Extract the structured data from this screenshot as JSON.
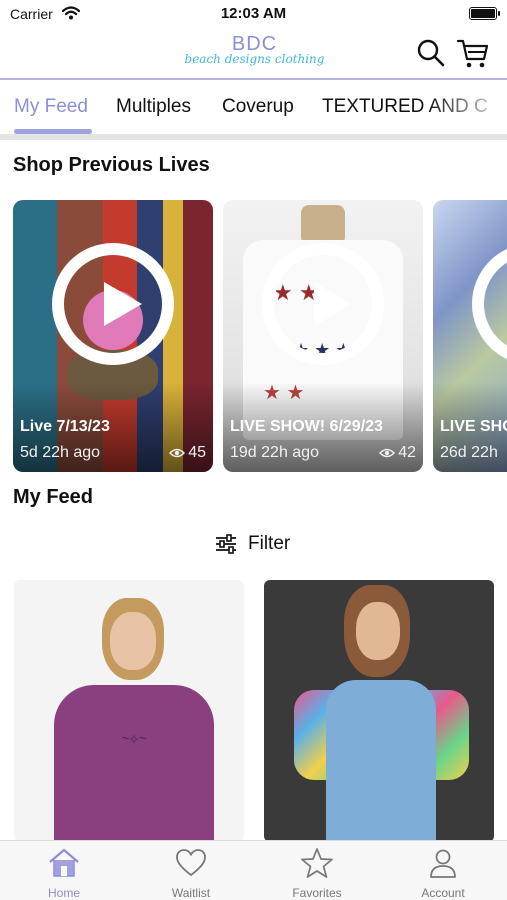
{
  "status_bar": {
    "carrier": "Carrier",
    "time": "12:03 AM"
  },
  "header": {
    "logo_mono": "BDC",
    "logo_script": "beach designs clothing"
  },
  "tabs": [
    {
      "label": "My Feed",
      "active": true
    },
    {
      "label": "Multiples",
      "active": false
    },
    {
      "label": "Coverup",
      "active": false
    },
    {
      "label": "TEXTURED AND C",
      "active": false
    }
  ],
  "sections": {
    "previous_lives": "Shop Previous Lives",
    "feed": "My Feed"
  },
  "lives": [
    {
      "title": "Live 7/13/23",
      "ago": "5d 22h ago",
      "views": "45"
    },
    {
      "title": "LIVE SHOW! 6/29/23",
      "ago": "19d 22h ago",
      "views": "42"
    },
    {
      "title": "LIVE SHO",
      "ago": "26d 22h",
      "views": ""
    }
  ],
  "filter": {
    "label": "Filter"
  },
  "bottom_nav": [
    {
      "label": "Home",
      "icon": "home-icon",
      "active": true
    },
    {
      "label": "Waitlist",
      "icon": "heart-icon",
      "active": false
    },
    {
      "label": "Favorites",
      "icon": "star-icon",
      "active": false
    },
    {
      "label": "Account",
      "icon": "person-icon",
      "active": false
    }
  ],
  "colors": {
    "accent": "#8b8fd6",
    "logo_script": "#3fb7d6",
    "divider": "#b3b3dd"
  }
}
